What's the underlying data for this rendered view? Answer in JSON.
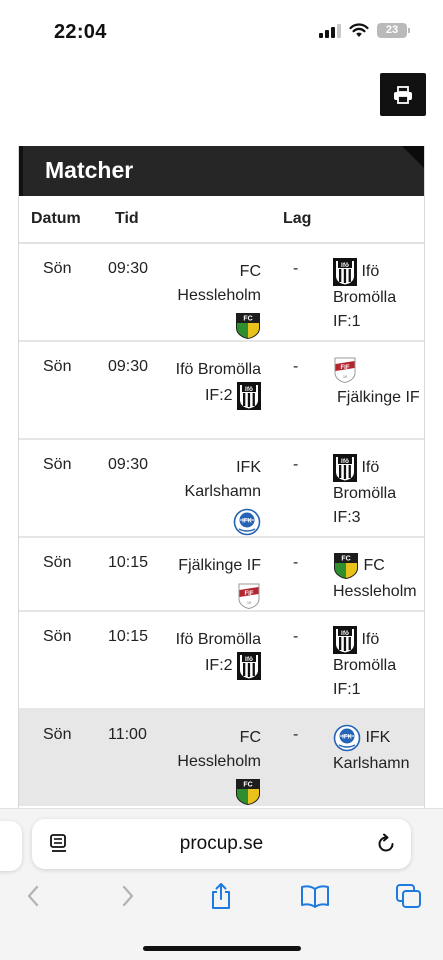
{
  "status": {
    "time": "22:04",
    "battery": "23"
  },
  "toolbar": {
    "print_label": ""
  },
  "panel": {
    "title": "Matcher"
  },
  "table": {
    "headers": {
      "date": "Datum",
      "time": "Tid",
      "team": "Lag"
    },
    "rows": [
      {
        "day": "Sön",
        "time": "09:30",
        "home": "FC Hessleholm",
        "home_logo": "fc-hessleholm",
        "dash": "-",
        "away": "Ifö Bromölla IF:1",
        "away_logo": "ifo-bromolla"
      },
      {
        "day": "Sön",
        "time": "09:30",
        "home": "Ifö Bromölla IF:2",
        "home_logo": "ifo-bromolla",
        "dash": "-",
        "away": "Fjälkinge IF",
        "away_logo": "fjalkinge-if"
      },
      {
        "day": "Sön",
        "time": "09:30",
        "home": "IFK Karlshamn",
        "home_logo": "ifk-karlshamn",
        "dash": "-",
        "away": "Ifö Bromölla IF:3",
        "away_logo": "ifo-bromolla"
      },
      {
        "day": "Sön",
        "time": "10:15",
        "home": "Fjälkinge IF",
        "home_logo": "fjalkinge-if",
        "dash": "-",
        "away": "FC Hessleholm",
        "away_logo": "fc-hessleholm"
      },
      {
        "day": "Sön",
        "time": "10:15",
        "home": "Ifö Bromölla IF:2",
        "home_logo": "ifo-bromolla",
        "dash": "-",
        "away": "Ifö Bromölla IF:1",
        "away_logo": "ifo-bromolla"
      },
      {
        "day": "Sön",
        "time": "11:00",
        "home": "FC Hessleholm",
        "home_logo": "fc-hessleholm",
        "dash": "-",
        "away": "IFK Karlshamn",
        "away_logo": "ifk-karlshamn"
      }
    ]
  },
  "browser": {
    "url": "procup.se"
  },
  "colors": {
    "header_bg": "#262626",
    "highlight_row": "#e7e7e7",
    "accent_blue": "#1f7ae0"
  }
}
